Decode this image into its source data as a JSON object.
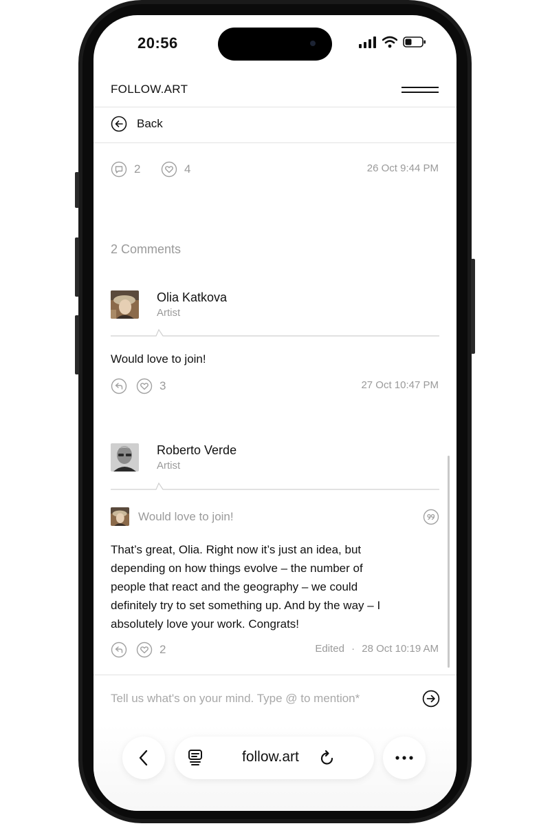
{
  "status_bar": {
    "time": "20:56"
  },
  "header": {
    "brand": "FOLLOW.ART"
  },
  "nav": {
    "back_label": "Back"
  },
  "post_stats": {
    "comment_count": "2",
    "like_count": "4",
    "timestamp": "26 Oct 9:44 PM"
  },
  "comments_section": {
    "title": "2 Comments",
    "comments": [
      {
        "author": "Olia Katkova",
        "role": "Artist",
        "text": "Would love to join!",
        "likes": "3",
        "timestamp": "27 Oct 10:47 PM"
      },
      {
        "author": "Roberto Verde",
        "role": "Artist",
        "quoted_text": "Would love to join!",
        "text_lines": [
          "That’s great, Olia. Right now it’s just an idea, but",
          "depending on how things evolve – the number of",
          "people that react and the geography – we could",
          "definitely try to set something up. And by the way – I",
          "absolutely love your work. Congrats!"
        ],
        "likes": "2",
        "edited_label": "Edited",
        "separator": "·",
        "timestamp": "28 Oct 10:19 AM"
      }
    ]
  },
  "composer": {
    "placeholder": "Tell us what's on your mind. Type @ to mention*"
  },
  "browser": {
    "url": "follow.art"
  },
  "icons": {
    "back": "arrow-left-circle-icon",
    "comment": "speech-bubble-icon",
    "like": "heart-icon",
    "reply": "reply-icon",
    "quote": "quote-icon",
    "send": "arrow-right-circle-icon",
    "tabs": "tabs-icon",
    "reload": "reload-icon",
    "more": "more-icon"
  }
}
